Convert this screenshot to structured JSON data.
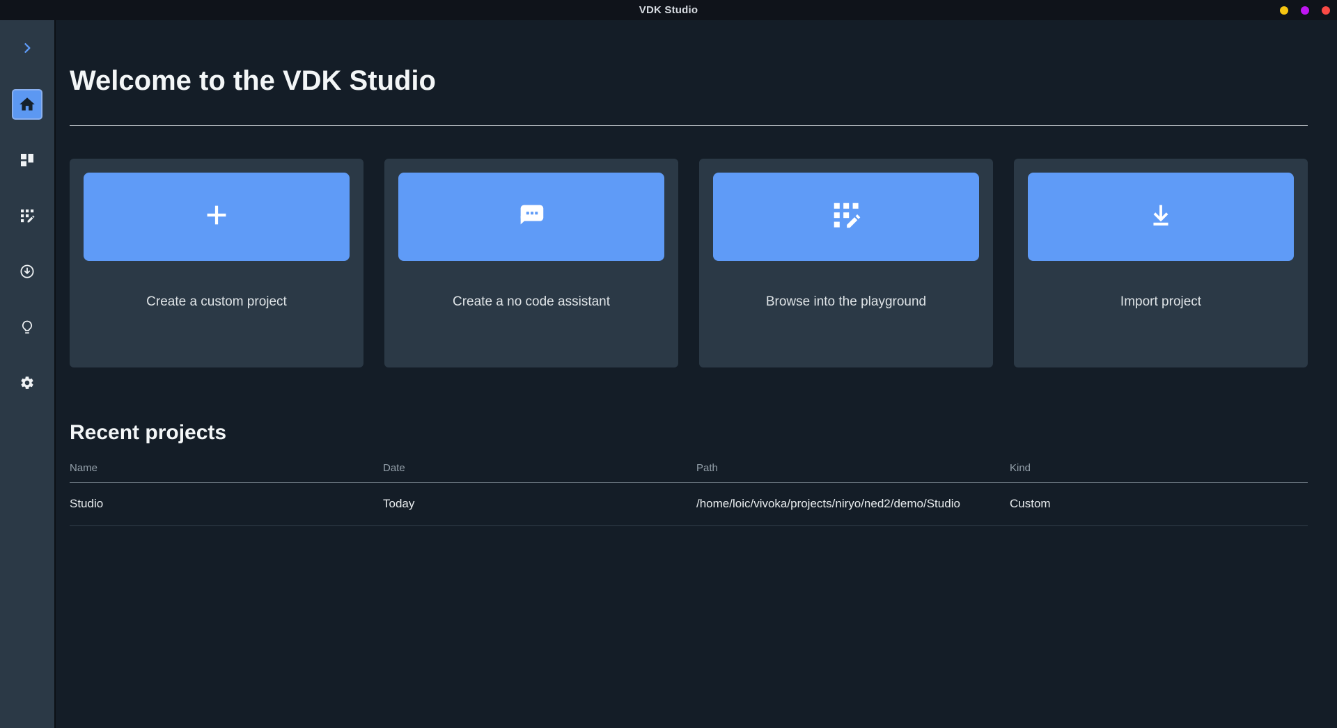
{
  "window": {
    "title": "VDK Studio",
    "controls": [
      {
        "name": "minimize-dot",
        "color": "#f6c511"
      },
      {
        "name": "maximize-dot",
        "color": "#bf16f2"
      },
      {
        "name": "close-dot",
        "color": "#fb4a45"
      }
    ]
  },
  "sidebar": {
    "collapse_icon": "chevron-right-icon",
    "items": [
      {
        "icon": "home-icon",
        "active": true
      },
      {
        "icon": "dashboard-icon",
        "active": false
      },
      {
        "icon": "grid-edit-icon",
        "active": false
      },
      {
        "icon": "download-circle-icon",
        "active": false
      },
      {
        "icon": "lightbulb-icon",
        "active": false
      },
      {
        "icon": "settings-gear-icon",
        "active": false
      }
    ]
  },
  "main": {
    "welcome_title": "Welcome to the VDK Studio",
    "cards": [
      {
        "label": "Create a custom project",
        "icon": "plus-icon"
      },
      {
        "label": "Create a no code assistant",
        "icon": "chat-ellipsis-icon"
      },
      {
        "label": "Browse into the playground",
        "icon": "grid-edit-icon"
      },
      {
        "label": "Import project",
        "icon": "download-icon"
      }
    ],
    "recent_projects": {
      "title": "Recent projects",
      "columns": [
        "Name",
        "Date",
        "Path",
        "Kind"
      ],
      "rows": [
        {
          "name": "Studio",
          "date": "Today",
          "path": "/home/loic/vivoka/projects/niryo/ned2/demo/Studio",
          "kind": "Custom"
        }
      ]
    }
  },
  "colors": {
    "accent_blue": "#5f9bf7",
    "main_bg": "#141d27",
    "panel_bg": "#2b3946",
    "titlebar_bg": "#0f131a"
  }
}
